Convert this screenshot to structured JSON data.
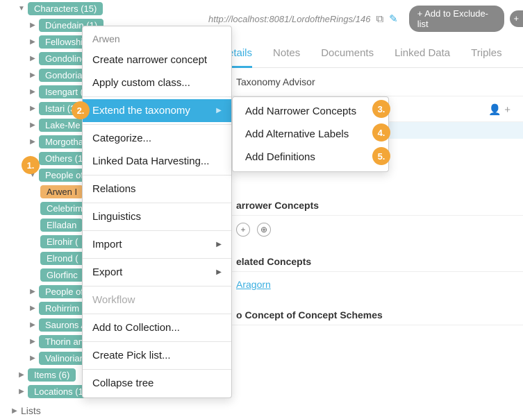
{
  "tree": {
    "root": "Characters (15)",
    "items": [
      "Dúnedain (1)",
      "Fellowship",
      "Gondolind",
      "Gondorian",
      "Isengart (3",
      "Istari (3)",
      "Lake-Me",
      "Morgotha",
      "Others (10",
      "People of I",
      "People of I",
      "Rohirrim (4",
      "Saurons A",
      "Thorin and",
      "Valinorians"
    ],
    "people_children": [
      "Arwen I",
      "Celebrim",
      "Elladan",
      "Elrohir (",
      "Elrond (",
      "Glorfinc"
    ],
    "after": [
      "Items (6)",
      "Locations (14"
    ],
    "lists": "Lists"
  },
  "context": {
    "title": "Arwen",
    "items": [
      {
        "label": "Create narrower concept"
      },
      {
        "label": "Apply custom class..."
      },
      {
        "sep": true
      },
      {
        "label": "Extend the taxonomy",
        "sub": true,
        "hover": true
      },
      {
        "sep": true
      },
      {
        "label": "Categorize..."
      },
      {
        "label": "Linked Data Harvesting..."
      },
      {
        "sep": true
      },
      {
        "label": "Relations"
      },
      {
        "sep": true
      },
      {
        "label": "Linguistics"
      },
      {
        "sep": true
      },
      {
        "label": "Import",
        "sub": true
      },
      {
        "sep": true
      },
      {
        "label": "Export",
        "sub": true
      },
      {
        "sep": true
      },
      {
        "label": "Workflow",
        "disabled": true
      },
      {
        "sep": true
      },
      {
        "label": "Add to Collection..."
      },
      {
        "sep": true
      },
      {
        "label": "Create Pick list..."
      },
      {
        "sep": true
      },
      {
        "label": "Collapse tree"
      }
    ]
  },
  "submenu": [
    "Add Narrower Concepts",
    "Add Alternative Labels",
    "Add Definitions"
  ],
  "badges": [
    "1.",
    "2.",
    "3.",
    "4.",
    "5."
  ],
  "main": {
    "url": "http://localhost:8081/LordoftheRings/146",
    "addExclude": "+ Add to Exclude-list",
    "tabs": [
      "etails",
      "Notes",
      "Documents",
      "Linked Data",
      "Triples"
    ],
    "advisor": "Taxonomy Advisor",
    "sections": {
      "narrower": "arrower Concepts",
      "related": "elated Concepts",
      "topconcept": "o Concept of Concept Schemes"
    },
    "relatedLink": "Aragorn"
  }
}
